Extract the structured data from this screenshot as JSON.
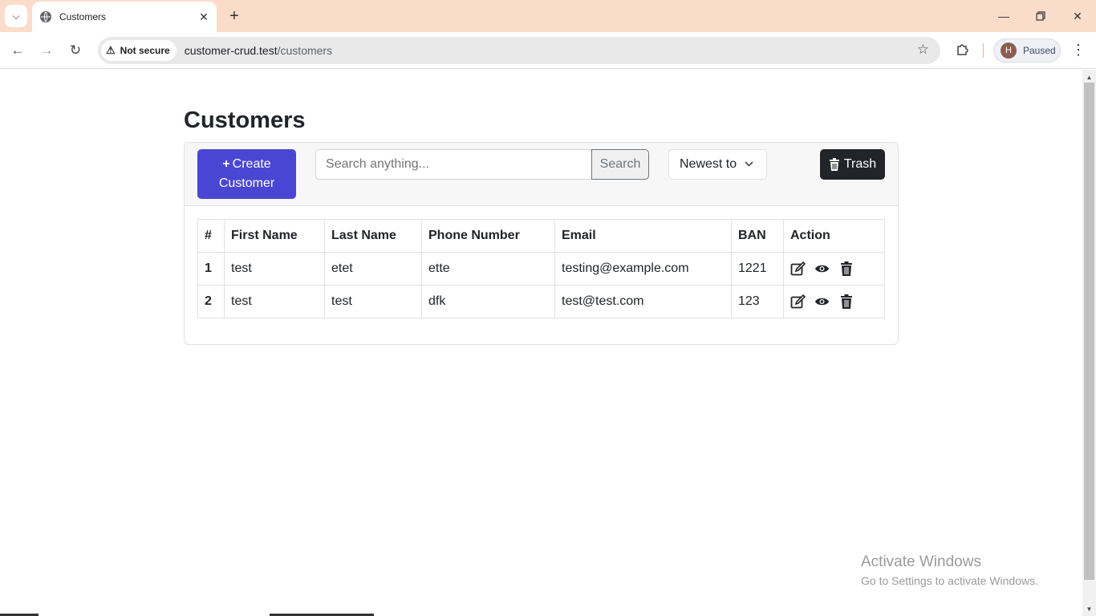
{
  "browser": {
    "tab_title": "Customers",
    "security_label": "Not secure",
    "url_domain": "customer-crud.test",
    "url_path": "/customers",
    "profile_initial": "H",
    "profile_status": "Paused"
  },
  "page": {
    "title": "Customers",
    "create_button_line1": "Create",
    "create_button_line2": "Customer",
    "search_placeholder": "Search anything...",
    "search_button": "Search",
    "sort_selected": "Newest to",
    "trash_button": "Trash",
    "accent_color": "#4a46d4"
  },
  "table": {
    "headers": [
      "#",
      "First Name",
      "Last Name",
      "Phone Number",
      "Email",
      "BAN",
      "Action"
    ],
    "rows": [
      {
        "num": "1",
        "first_name": "test",
        "last_name": "etet",
        "phone": "ette",
        "email": "testing@example.com",
        "ban": "1221"
      },
      {
        "num": "2",
        "first_name": "test",
        "last_name": "test",
        "phone": "dfk",
        "email": "test@test.com",
        "ban": "123"
      }
    ]
  },
  "watermark": {
    "line1": "Activate Windows",
    "line2": "Go to Settings to activate Windows."
  }
}
